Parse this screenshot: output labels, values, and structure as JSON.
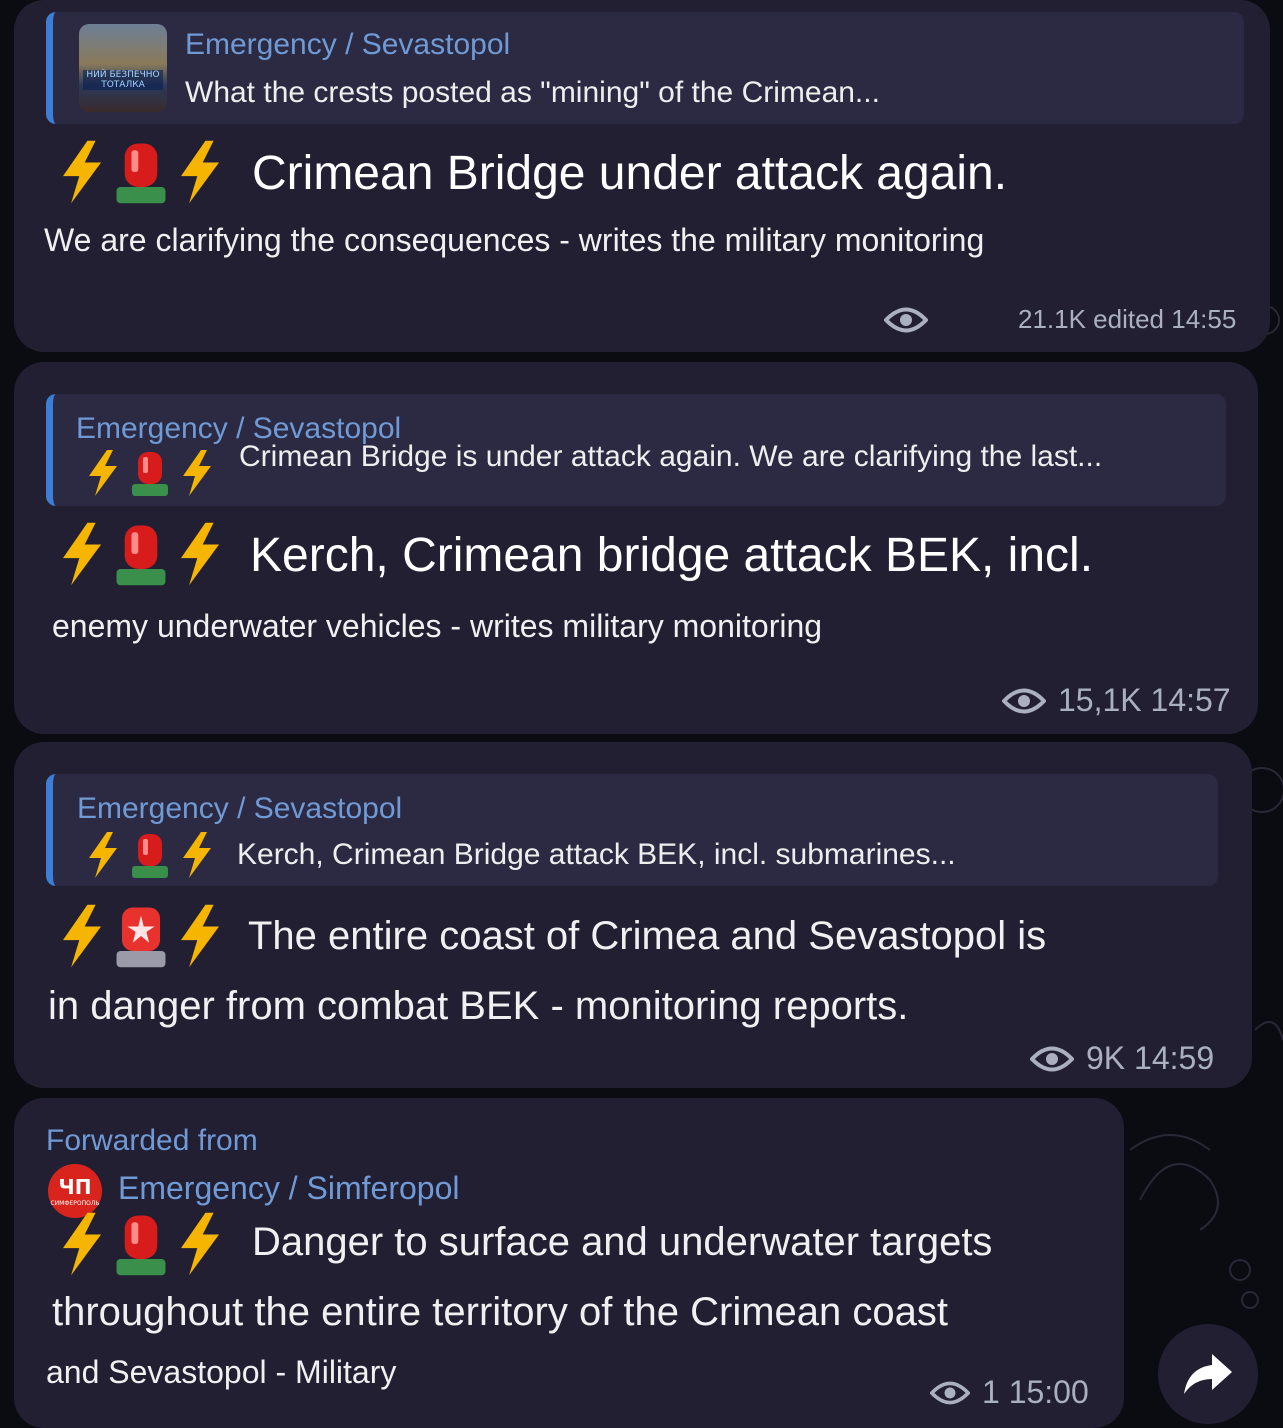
{
  "colors": {
    "bubble": "#221f33",
    "reply_bar": "#3d7fd6",
    "link": "#6f9ad6",
    "meta": "#aab0c0"
  },
  "messages": [
    {
      "reply": {
        "name": "Emergency / Sevastopol",
        "text": "What the crests posted as \"mining\" of the Crimean...",
        "thumb_text": "НИЙ БЕЗПЕЧНО ТОТАЛКА"
      },
      "headline": "Crimean Bridge under attack again.",
      "body": [
        "We are clarifying the consequences - writes the military monitoring"
      ],
      "views": "21.1K edited 14:55"
    },
    {
      "reply": {
        "name": "Emergency / Sevastopol",
        "text": "Crimean Bridge is under attack again. We are clarifying the last..."
      },
      "headline": "Kerch, Crimean bridge attack BEK, incl.",
      "body": [
        "enemy underwater vehicles - writes military monitoring"
      ],
      "views": "15,1K 14:57"
    },
    {
      "reply": {
        "name": "Emergency / Sevastopol",
        "text": "Kerch, Crimean Bridge attack BEK, incl. submarines..."
      },
      "headline": "The entire coast of Crimea and Sevastopol is",
      "body": [
        "in danger from combat BEK - monitoring reports."
      ],
      "views": "9K 14:59"
    },
    {
      "forwarded_label": "Forwarded from",
      "forward_name": "Emergency / Simferopol",
      "avatar_text": "ЧП",
      "avatar_sub": "СИМФЕРОПОЛЬ",
      "headline": "Danger to surface and underwater targets",
      "body": [
        "throughout the entire territory of the Crimean coast",
        "and Sevastopol - Military"
      ],
      "views": "1 15:00"
    }
  ],
  "icons": [
    "eye-icon",
    "bolt-icon",
    "siren-icon",
    "share-icon"
  ]
}
